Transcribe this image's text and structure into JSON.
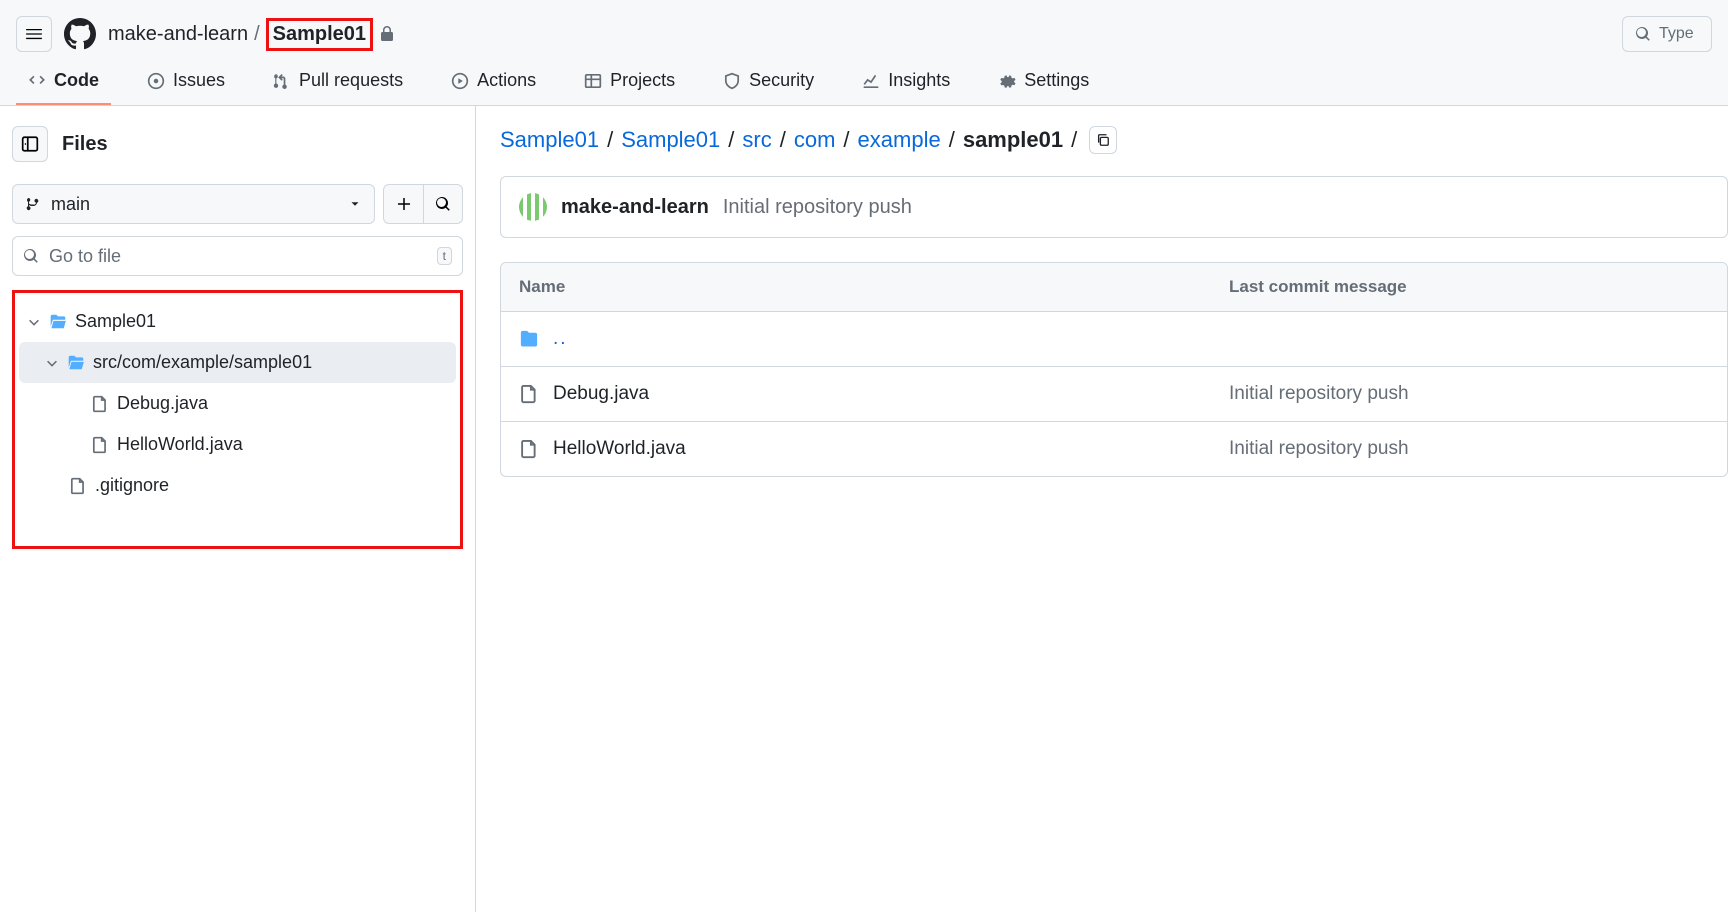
{
  "header": {
    "owner": "make-and-learn",
    "repo": "Sample01",
    "search_placeholder": "Type"
  },
  "nav": {
    "code": "Code",
    "issues": "Issues",
    "pulls": "Pull requests",
    "actions": "Actions",
    "projects": "Projects",
    "security": "Security",
    "insights": "Insights",
    "settings": "Settings"
  },
  "sidebar": {
    "title": "Files",
    "branch": "main",
    "filter_placeholder": "Go to file",
    "filter_kbd": "t",
    "tree": {
      "root": "Sample01",
      "srcpath": "src/com/example/sample01",
      "files": [
        "Debug.java",
        "HelloWorld.java"
      ],
      "gitignore": ".gitignore"
    }
  },
  "breadcrumb": {
    "parts": [
      "Sample01",
      "Sample01",
      "src",
      "com",
      "example"
    ],
    "current": "sample01"
  },
  "commit": {
    "author": "make-and-learn",
    "message": "Initial repository push"
  },
  "table": {
    "col_name": "Name",
    "col_msg": "Last commit message",
    "up": "..",
    "rows": [
      {
        "name": "Debug.java",
        "msg": "Initial repository push"
      },
      {
        "name": "HelloWorld.java",
        "msg": "Initial repository push"
      }
    ]
  }
}
